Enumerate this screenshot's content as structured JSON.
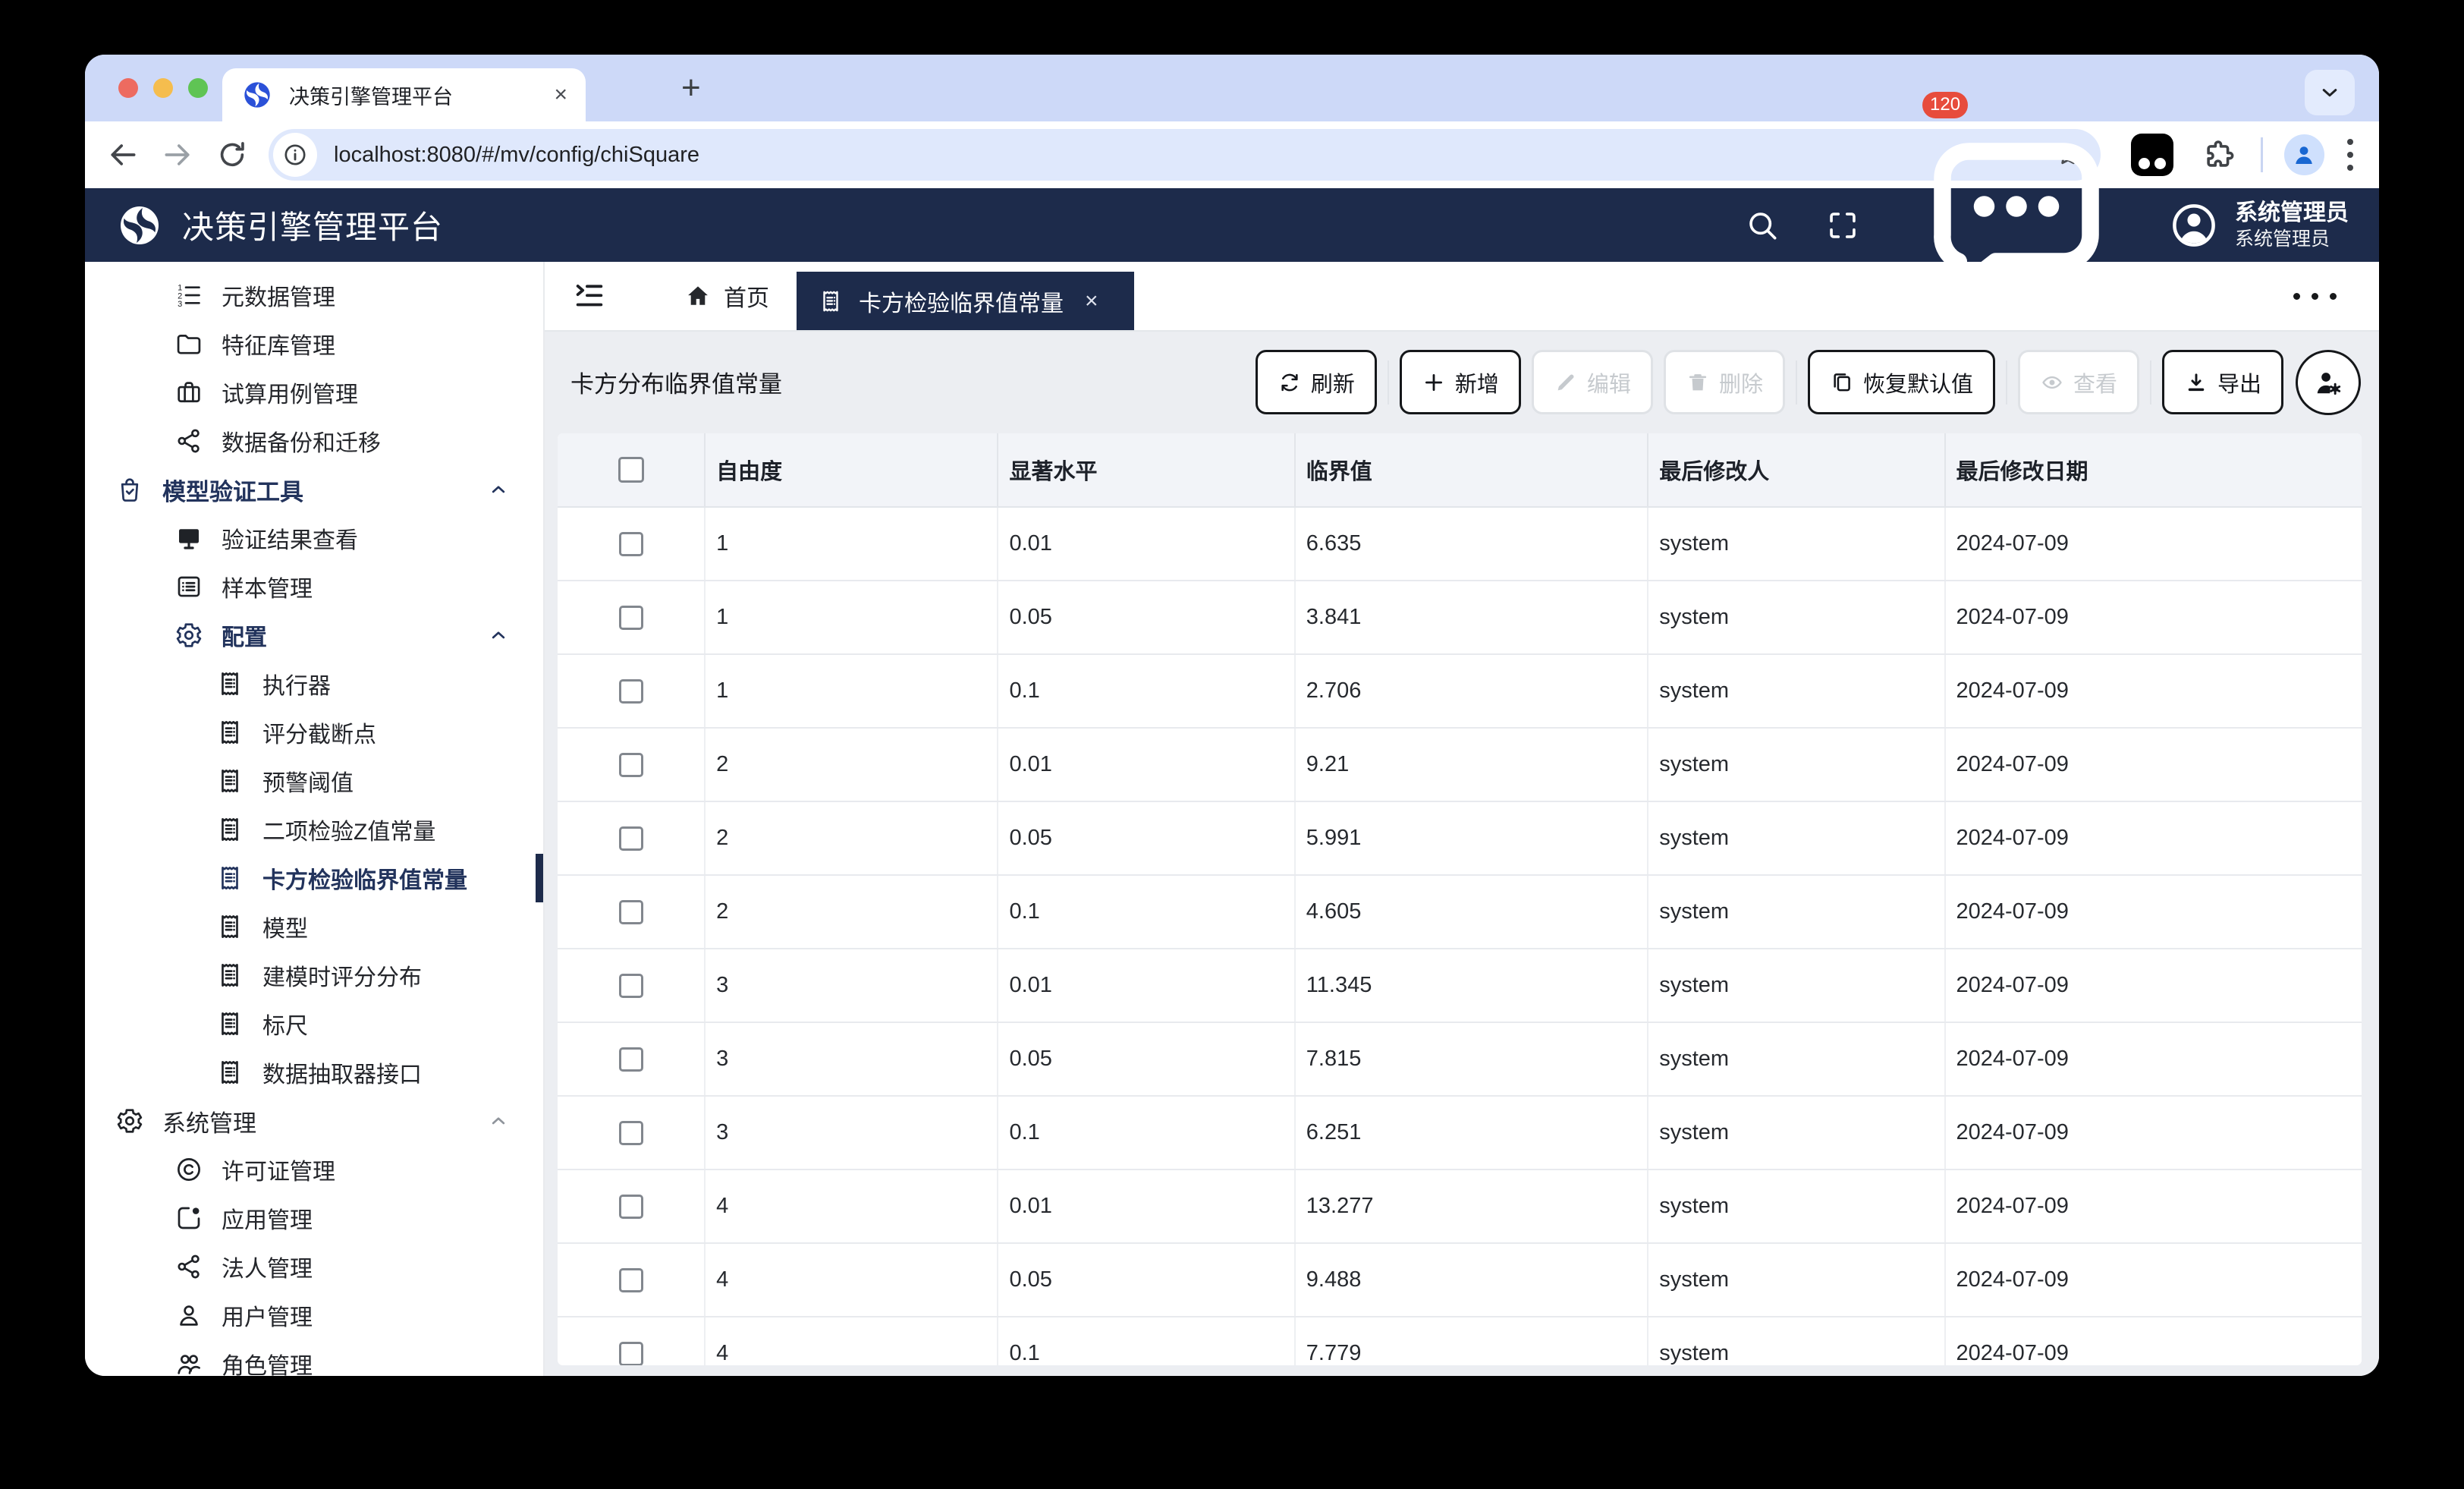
{
  "colors": {
    "accent_navy": "#1d2b4b",
    "badge_red": "#e74c3c",
    "favicon_blue": "#2b51d8",
    "chrome_strip": "#cdd9f8",
    "content_bg": "#eceef2",
    "traffic_red": "#ed6b60",
    "traffic_yellow": "#f5bd4e",
    "traffic_green": "#5fc454"
  },
  "browser": {
    "tab_title": "决策引擎管理平台",
    "url": "localhost:8080/#/mv/config/chiSquare"
  },
  "header": {
    "app_title": "决策引擎管理平台",
    "badge_count": "120",
    "user_name": "系统管理员",
    "user_role": "系统管理员"
  },
  "sidebar": {
    "items": [
      {
        "name": "sidebar-item-metadata",
        "label": "元数据管理",
        "icon": "ordered-list-icon",
        "level": 2
      },
      {
        "name": "sidebar-item-feature-lib",
        "label": "特征库管理",
        "icon": "folder-icon",
        "level": 2
      },
      {
        "name": "sidebar-item-trial-case",
        "label": "试算用例管理",
        "icon": "briefcase-icon",
        "level": 2
      },
      {
        "name": "sidebar-item-backup",
        "label": "数据备份和迁移",
        "icon": "share-icon",
        "level": 2
      },
      {
        "name": "sidebar-group-model-validate",
        "label": "模型验证工具",
        "icon": "bag-check-icon",
        "level": 1,
        "active": true,
        "chevron": "up"
      },
      {
        "name": "sidebar-item-validate-result",
        "label": "验证结果查看",
        "icon": "monitor-icon",
        "level": 2
      },
      {
        "name": "sidebar-item-sample",
        "label": "样本管理",
        "icon": "list-panel-icon",
        "level": 2
      },
      {
        "name": "sidebar-group-config",
        "label": "配置",
        "icon": "gear-icon",
        "level": 2,
        "active": true,
        "chevron": "up"
      },
      {
        "name": "sidebar-item-executor",
        "label": "执行器",
        "icon": "receipt-icon",
        "level": 3
      },
      {
        "name": "sidebar-item-score-cutoff",
        "label": "评分截断点",
        "icon": "receipt-icon",
        "level": 3
      },
      {
        "name": "sidebar-item-alert-threshold",
        "label": "预警阈值",
        "icon": "receipt-icon",
        "level": 3
      },
      {
        "name": "sidebar-item-binomial-z",
        "label": "二项检验Z值常量",
        "icon": "receipt-icon",
        "level": 3
      },
      {
        "name": "sidebar-item-chi-square",
        "label": "卡方检验临界值常量",
        "icon": "receipt-icon",
        "level": 3,
        "active": true,
        "selected": true
      },
      {
        "name": "sidebar-item-model",
        "label": "模型",
        "icon": "receipt-icon",
        "level": 3
      },
      {
        "name": "sidebar-item-score-dist",
        "label": "建模时评分分布",
        "icon": "receipt-icon",
        "level": 3
      },
      {
        "name": "sidebar-item-ruler",
        "label": "标尺",
        "icon": "receipt-icon",
        "level": 3
      },
      {
        "name": "sidebar-item-extractor-api",
        "label": "数据抽取器接口",
        "icon": "receipt-icon",
        "level": 3
      },
      {
        "name": "sidebar-group-system",
        "label": "系统管理",
        "icon": "gear-icon",
        "level": 1,
        "chevron": "up"
      },
      {
        "name": "sidebar-item-license",
        "label": "许可证管理",
        "icon": "copyright-icon",
        "level": 2
      },
      {
        "name": "sidebar-item-application",
        "label": "应用管理",
        "icon": "app-box-icon",
        "level": 2
      },
      {
        "name": "sidebar-item-legal-entity",
        "label": "法人管理",
        "icon": "share-icon",
        "level": 2
      },
      {
        "name": "sidebar-item-user",
        "label": "用户管理",
        "icon": "user-icon",
        "level": 2
      },
      {
        "name": "sidebar-item-role",
        "label": "角色管理",
        "icon": "users-icon",
        "level": 2
      }
    ]
  },
  "tabbar": {
    "home_label": "首页",
    "active_tab_label": "卡方检验临界值常量",
    "close_label": "×"
  },
  "page": {
    "title": "卡方分布临界值常量"
  },
  "toolbar": {
    "buttons": [
      {
        "name": "refresh-button",
        "label": "刷新",
        "icon": "refresh-icon",
        "enabled": true
      },
      {
        "sep": true
      },
      {
        "name": "add-button",
        "label": "新增",
        "icon": "plus-icon",
        "enabled": true
      },
      {
        "name": "edit-button",
        "label": "编辑",
        "icon": "pencil-icon",
        "enabled": false
      },
      {
        "name": "delete-button",
        "label": "删除",
        "icon": "trash-icon",
        "enabled": false
      },
      {
        "sep": true
      },
      {
        "name": "restore-defaults-button",
        "label": "恢复默认值",
        "icon": "restore-icon",
        "enabled": true
      },
      {
        "sep": true
      },
      {
        "name": "view-button",
        "label": "查看",
        "icon": "view-icon",
        "enabled": false
      },
      {
        "sep": true
      },
      {
        "name": "export-button",
        "label": "导出",
        "icon": "export-icon",
        "enabled": true
      },
      {
        "name": "column-settings-button",
        "label": "",
        "icon": "user-gear-icon",
        "enabled": true,
        "circle": true
      }
    ]
  },
  "table": {
    "columns": [
      "自由度",
      "显著水平",
      "临界值",
      "最后修改人",
      "最后修改日期"
    ],
    "rows": [
      [
        "1",
        "0.01",
        "6.635",
        "system",
        "2024-07-09"
      ],
      [
        "1",
        "0.05",
        "3.841",
        "system",
        "2024-07-09"
      ],
      [
        "1",
        "0.1",
        "2.706",
        "system",
        "2024-07-09"
      ],
      [
        "2",
        "0.01",
        "9.21",
        "system",
        "2024-07-09"
      ],
      [
        "2",
        "0.05",
        "5.991",
        "system",
        "2024-07-09"
      ],
      [
        "2",
        "0.1",
        "4.605",
        "system",
        "2024-07-09"
      ],
      [
        "3",
        "0.01",
        "11.345",
        "system",
        "2024-07-09"
      ],
      [
        "3",
        "0.05",
        "7.815",
        "system",
        "2024-07-09"
      ],
      [
        "3",
        "0.1",
        "6.251",
        "system",
        "2024-07-09"
      ],
      [
        "4",
        "0.01",
        "13.277",
        "system",
        "2024-07-09"
      ],
      [
        "4",
        "0.05",
        "9.488",
        "system",
        "2024-07-09"
      ],
      [
        "4",
        "0.1",
        "7.779",
        "system",
        "2024-07-09"
      ]
    ]
  }
}
